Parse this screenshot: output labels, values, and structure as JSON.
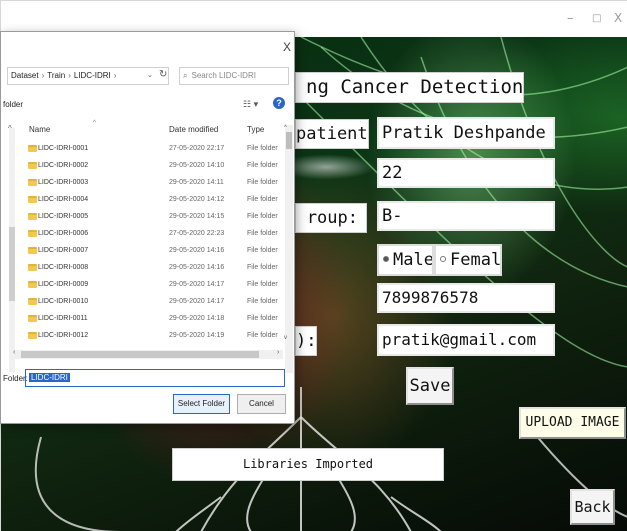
{
  "app": {
    "window_controls": {
      "minimize": "–",
      "maximize": "□",
      "close": "X"
    },
    "title": "ng Cancer Detection",
    "labels": {
      "patient_name": "patient:",
      "blood_group": "roup:",
      "email": "):"
    },
    "fields": {
      "name": "Pratik Deshpande",
      "age": "22",
      "blood_group": "B-",
      "phone": "7899876578",
      "email": "pratik@gmail.com"
    },
    "gender": {
      "male": "Male",
      "female": "Female",
      "selected": "Male"
    },
    "buttons": {
      "save": "Save",
      "upload": "UPLOAD IMAGE",
      "back": "Back"
    },
    "status": "Libraries Imported"
  },
  "dialog": {
    "close": "X",
    "breadcrumb": [
      "Dataset",
      "Train",
      "LIDC-IDRI"
    ],
    "search_placeholder": "Search LIDC-IDRI",
    "folder_label": "folder",
    "columns": {
      "name": "Name",
      "date": "Date modified",
      "type": "Type"
    },
    "rows": [
      {
        "name": "LIDC-IDRI-0001",
        "date": "27-05-2020 22:17",
        "type": "File folder"
      },
      {
        "name": "LIDC-IDRI-0002",
        "date": "29-05-2020 14:10",
        "type": "File folder"
      },
      {
        "name": "LIDC-IDRI-0003",
        "date": "29-05-2020 14:11",
        "type": "File folder"
      },
      {
        "name": "LIDC-IDRI-0004",
        "date": "29-05-2020 14:12",
        "type": "File folder"
      },
      {
        "name": "LIDC-IDRI-0005",
        "date": "29-05-2020 14:15",
        "type": "File folder"
      },
      {
        "name": "LIDC-IDRI-0006",
        "date": "27-05-2020 22:23",
        "type": "File folder"
      },
      {
        "name": "LIDC-IDRI-0007",
        "date": "29-05-2020 14:16",
        "type": "File folder"
      },
      {
        "name": "LIDC-IDRI-0008",
        "date": "29-05-2020 14:16",
        "type": "File folder"
      },
      {
        "name": "LIDC-IDRI-0009",
        "date": "29-05-2020 14:17",
        "type": "File folder"
      },
      {
        "name": "LIDC-IDRI-0010",
        "date": "29-05-2020 14:17",
        "type": "File folder"
      },
      {
        "name": "LIDC-IDRI-0011",
        "date": "29-05-2020 14:18",
        "type": "File folder"
      },
      {
        "name": "LIDC-IDRI-0012",
        "date": "29-05-2020 14:19",
        "type": "File folder"
      }
    ],
    "folder_field_label": "Folder:",
    "folder_value": "LIDC-IDRI",
    "select_button": "Select Folder",
    "cancel_button": "Cancel"
  },
  "colors": {
    "accent": "#2a66c8",
    "folder": "#f2c94c",
    "background": "#0b3515"
  }
}
